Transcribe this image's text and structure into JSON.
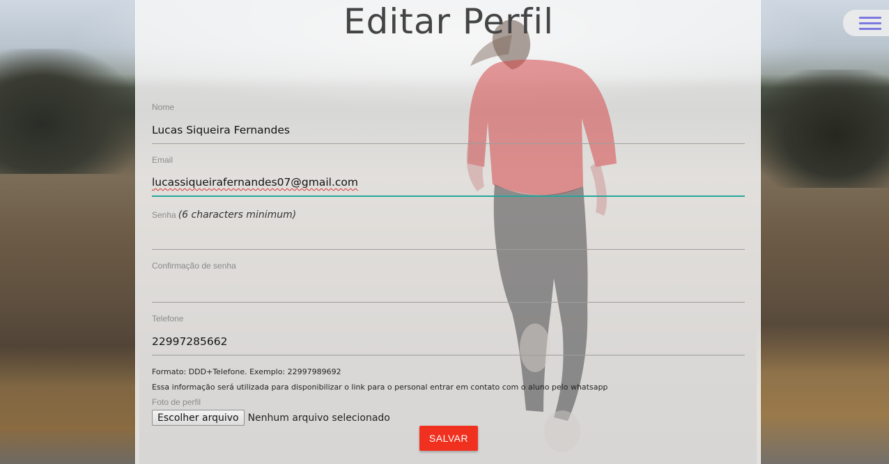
{
  "page": {
    "title": "Editar Perfil"
  },
  "form": {
    "name": {
      "label": "Nome",
      "value": "Lucas Siqueira Fernandes"
    },
    "email": {
      "label": "Email",
      "value": "lucassiqueirafernandes07@gmail.com"
    },
    "password": {
      "label": "Senha",
      "hint": "(6 characters minimum)",
      "value": ""
    },
    "password_confirmation": {
      "label": "Confirmação de senha",
      "value": ""
    },
    "phone": {
      "label": "Telefone",
      "value": "22997285662",
      "format_hint": "Formato: DDD+Telefone. Exemplo: 22997989692",
      "usage_hint": "Essa informação será utilizada para disponibilizar o link para o personal entrar em contato com o aluno pelo whatsapp"
    },
    "photo": {
      "label": "Foto de perfil",
      "button_label": "Escolher arquivo",
      "status": "Nenhum arquivo selecionado"
    },
    "save_label": "SALVAR"
  },
  "icons": {
    "menu": "hamburger-menu-icon"
  },
  "colors": {
    "save_button": "#f0311f",
    "active_underline": "#26a69a",
    "menu_icon": "#7b78e0",
    "title": "#444444"
  }
}
